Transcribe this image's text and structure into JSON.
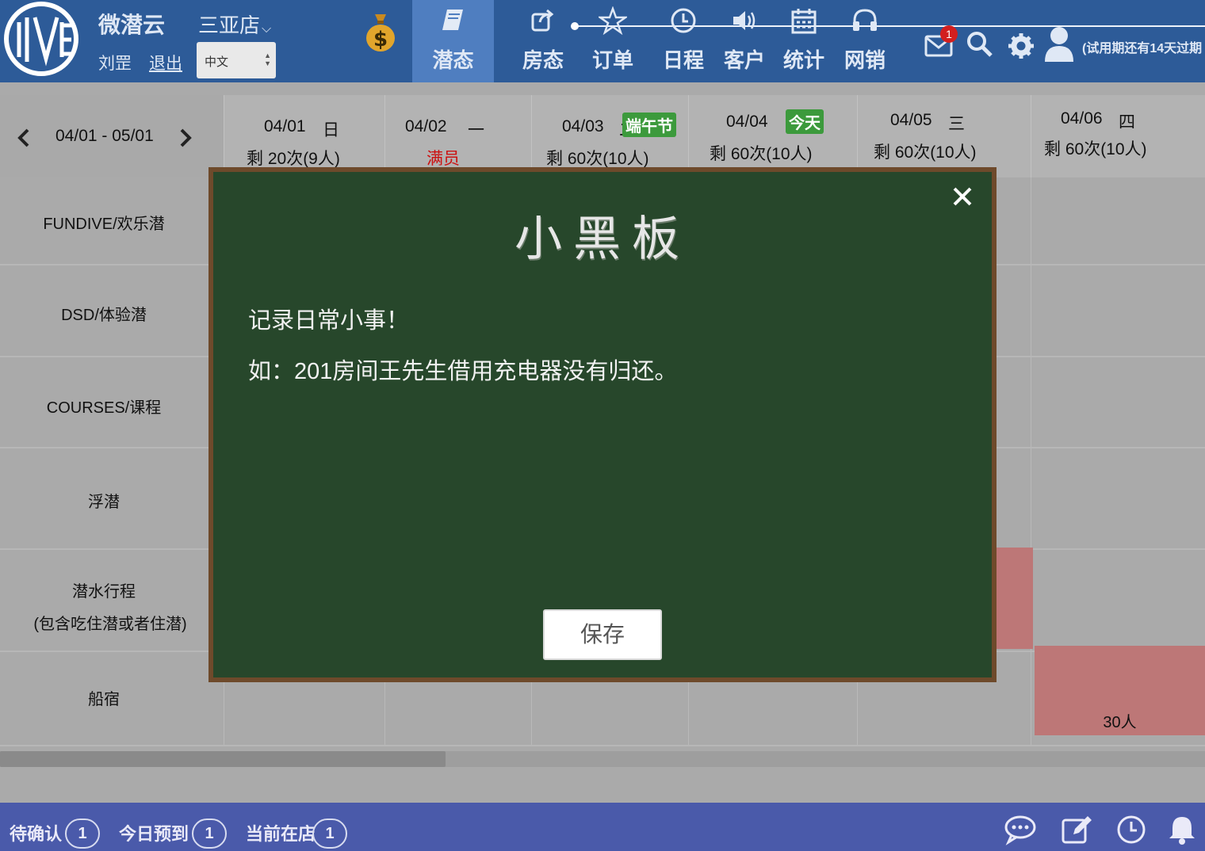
{
  "header": {
    "brand": "微潜云",
    "store": "三亚店",
    "store_chevron": "⌵",
    "user_name": "刘罡",
    "logout": "退出",
    "language": "中文",
    "nav": [
      {
        "label": "潜态",
        "icon": "book-icon",
        "active": true
      },
      {
        "label": "房态",
        "icon": "share-icon",
        "active": false
      },
      {
        "label": "订单",
        "icon": "star-icon",
        "active": false
      },
      {
        "label": "日程",
        "icon": "clock-icon",
        "active": false
      },
      {
        "label": "客户",
        "icon": "speaker-icon",
        "active": false
      },
      {
        "label": "统计",
        "icon": "calendar-icon",
        "active": false
      },
      {
        "label": "网销",
        "icon": "headphones-icon",
        "active": false
      }
    ],
    "mail_badge": "1",
    "trial_notice": "(试用期还有14天过期"
  },
  "calendar": {
    "range": "04/01 - 05/01",
    "days": [
      {
        "date": "04/01",
        "weekday": "日",
        "remaining": "剩 20次(9人)",
        "tag": ""
      },
      {
        "date": "04/02",
        "weekday": "一",
        "remaining": "满员",
        "tag": ""
      },
      {
        "date": "04/03",
        "weekday": "二",
        "remaining": "剩 60次(10人)",
        "tag": "端午节"
      },
      {
        "date": "04/04",
        "weekday": "",
        "remaining": "剩 60次(10人)",
        "tag": "今天"
      },
      {
        "date": "04/05",
        "weekday": "三",
        "remaining": "剩 60次(10人)",
        "tag": ""
      },
      {
        "date": "04/06",
        "weekday": "四",
        "remaining": "剩 60次(10人)",
        "tag": ""
      }
    ],
    "rows": [
      "FUNDIVE/欢乐潜",
      "DSD/体验潜",
      "COURSES/课程",
      "浮潜",
      "潜水行程",
      "(包含吃住潜或者住潜)",
      "船宿"
    ],
    "booking_count": "30人"
  },
  "blackboard": {
    "title": "小黑板",
    "line1": "记录日常小事！",
    "line2": "如：201房间王先生借用充电器没有归还。",
    "save": "保存"
  },
  "footer": {
    "pending_label": "待确认",
    "pending_count": "1",
    "arrivals_label": "今日预到",
    "arrivals_count": "1",
    "instore_label": "当前在店",
    "instore_count": "1"
  },
  "colors": {
    "topbar": "#2d5b98",
    "nav_active": "#4f7ec0",
    "board": "#27472b",
    "board_frame": "#6e4a2b",
    "booking": "#bd7777",
    "holiday_tag": "#3c9a3c",
    "full_text": "#cc1111",
    "bottombar": "#4a5aaa"
  }
}
